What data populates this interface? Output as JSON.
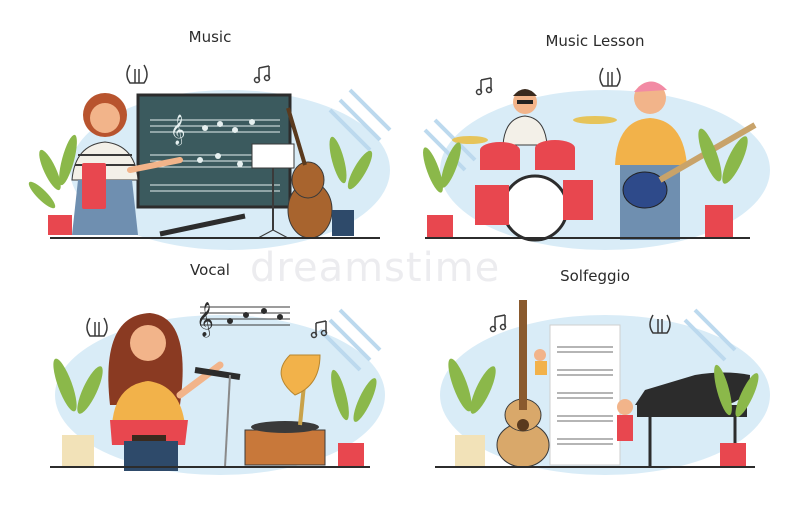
{
  "panels": [
    {
      "title": "Music",
      "icon": "lyre-icon"
    },
    {
      "title": "Music Lesson",
      "icon": "lyre-icon"
    },
    {
      "title": "Vocal",
      "icon": "lyre-icon"
    },
    {
      "title": "Solfeggio",
      "icon": "lyre-icon"
    }
  ],
  "watermark": "dreamstime",
  "colors": {
    "bg_blob": "#d9ecf7",
    "stripes": "#bcd9ee",
    "plant": "#8bb84a",
    "pot": "#e8474f",
    "skin": "#f2b48a",
    "outline": "#3a3a3a"
  }
}
